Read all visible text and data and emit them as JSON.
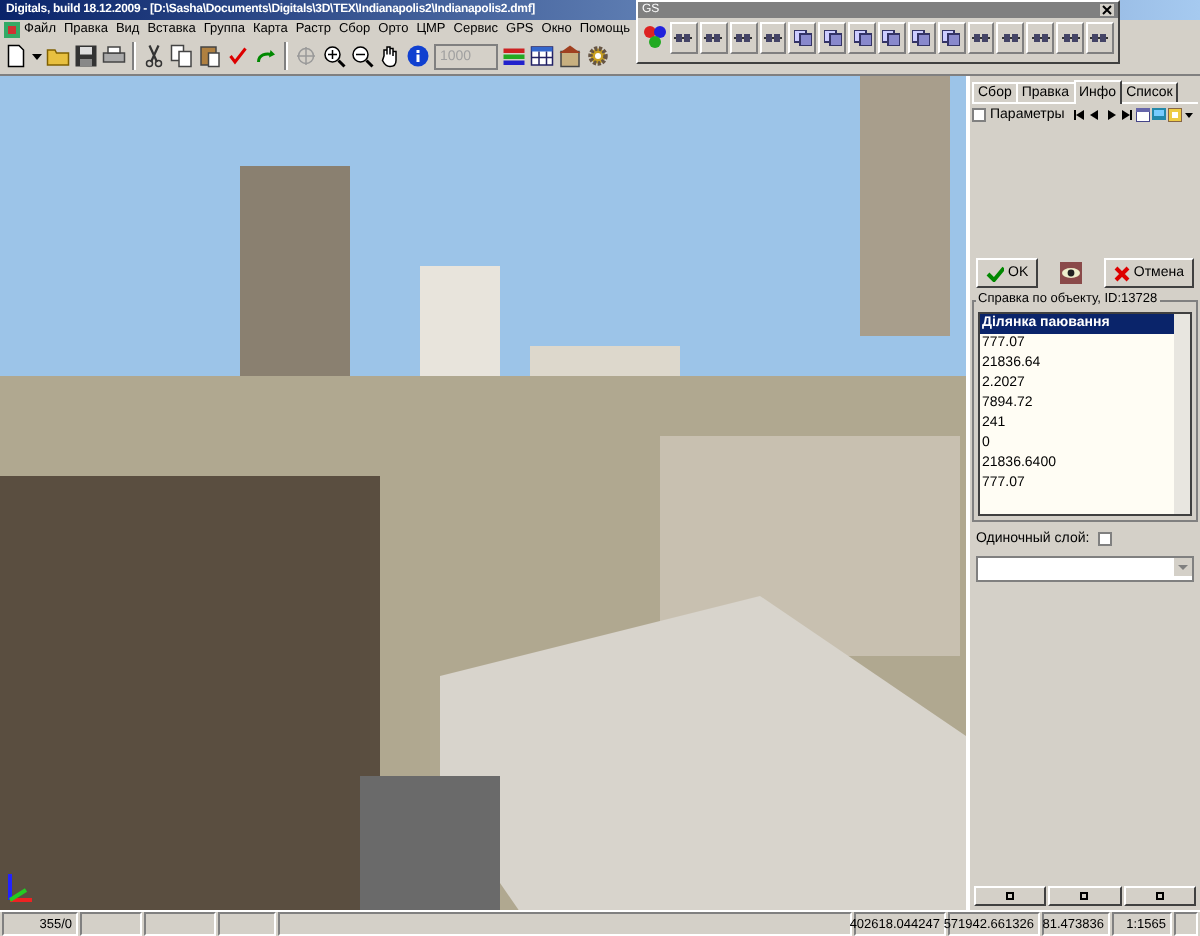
{
  "window": {
    "title": "Digitals, build 18.12.2009 - [D:\\Sasha\\Documents\\Digitals\\3D\\TEX\\Indianapolis2\\Indianapolis2.dmf]"
  },
  "menu": [
    "Файл",
    "Правка",
    "Вид",
    "Вставка",
    "Группа",
    "Карта",
    "Растр",
    "Сбор",
    "Орто",
    "ЦМР",
    "Сервис",
    "GPS",
    "Окно",
    "Помощь"
  ],
  "toolbar": {
    "scale_field": {
      "value": "1000",
      "disabled": true
    }
  },
  "floating_toolbar": {
    "title": "GS"
  },
  "side_panel": {
    "tabs": [
      {
        "label": "Сбор",
        "selected": false
      },
      {
        "label": "Правка",
        "selected": false
      },
      {
        "label": "Инфо",
        "selected": true
      },
      {
        "label": "Список",
        "selected": false
      }
    ],
    "parameters": {
      "label": "Параметры",
      "checked": false
    },
    "ok_button": "OK",
    "cancel_button": "Отмена",
    "info_group": {
      "title": "Справка по объекту, ID:13728",
      "items": [
        {
          "text": "Ділянка паювання",
          "selected": true
        },
        {
          "text": "777.07",
          "selected": false
        },
        {
          "text": "21836.64",
          "selected": false
        },
        {
          "text": "2.2027",
          "selected": false
        },
        {
          "text": "7894.72",
          "selected": false
        },
        {
          "text": "241",
          "selected": false
        },
        {
          "text": "0",
          "selected": false
        },
        {
          "text": "21836.6400",
          "selected": false
        },
        {
          "text": "777.07",
          "selected": false
        }
      ]
    },
    "single_layer": {
      "label": "Одиночный слой:",
      "checked": false
    }
  },
  "status_bar": [
    "355/0",
    "402618.044247",
    "571942.661326",
    "81.473836",
    "1:1565"
  ]
}
